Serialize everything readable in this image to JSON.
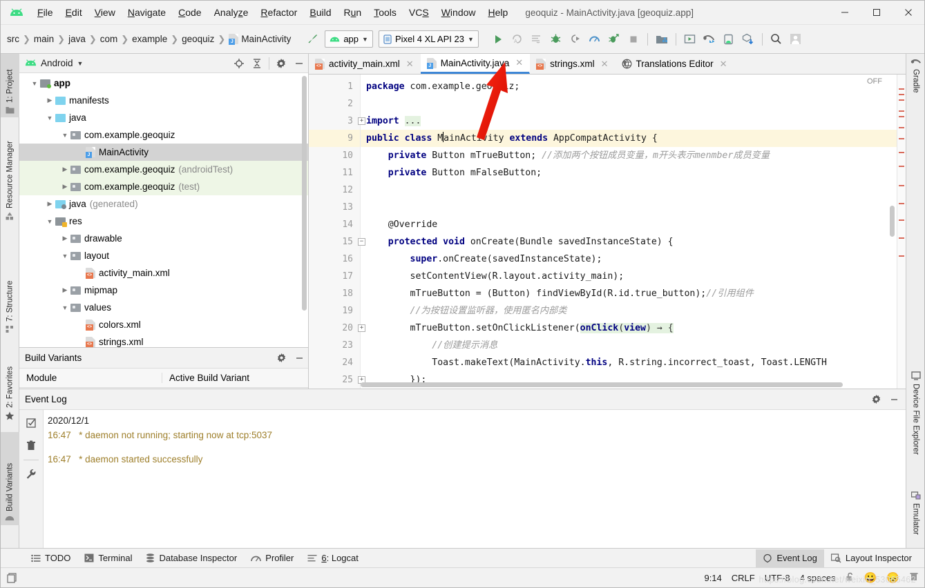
{
  "window": {
    "title": "geoquiz - MainActivity.java [geoquiz.app]",
    "minimize": "—",
    "maximize": "▫",
    "close": "✕"
  },
  "menu": [
    {
      "label": "File",
      "accel": "F"
    },
    {
      "label": "Edit",
      "accel": "E"
    },
    {
      "label": "View",
      "accel": "V"
    },
    {
      "label": "Navigate",
      "accel": "N"
    },
    {
      "label": "Code",
      "accel": "C"
    },
    {
      "label": "Analyze",
      "accel": "z"
    },
    {
      "label": "Refactor",
      "accel": "R"
    },
    {
      "label": "Build",
      "accel": "B"
    },
    {
      "label": "Run",
      "accel": "u"
    },
    {
      "label": "Tools",
      "accel": "T"
    },
    {
      "label": "VCS",
      "accel": "S"
    },
    {
      "label": "Window",
      "accel": "W"
    },
    {
      "label": "Help",
      "accel": "H"
    }
  ],
  "breadcrumbs": [
    "src",
    "main",
    "java",
    "com",
    "example",
    "geoquiz",
    "MainActivity"
  ],
  "toolbar": {
    "module_selector": "app",
    "device_selector": "Pixel 4 XL API 23",
    "icons": [
      "run-icon",
      "rerun-icon",
      "run-with-coverage-icon",
      "debug-icon",
      "attach-debugger-icon",
      "profiler-icon",
      "debug-app-icon",
      "stop-icon",
      "sdk-manager-icon",
      "avd-manager-icon",
      "sync-gradle-icon",
      "device-manager-icon",
      "download-component-icon",
      "search-icon",
      "account-icon"
    ],
    "make_project_icon": "hammer-icon"
  },
  "left_tool_strip": [
    {
      "label": "1: Project",
      "accel": "1",
      "icon": "project-folder-icon",
      "selected": true
    },
    {
      "label": "Resource Manager",
      "icon": "resource-manager-icon",
      "selected": false
    },
    {
      "label": "7: Structure",
      "accel": "7",
      "icon": "structure-icon",
      "selected": false
    },
    {
      "label": "2: Favorites",
      "accel": "2",
      "icon": "star-icon",
      "selected": false
    },
    {
      "label": "Build Variants",
      "icon": "android-icon",
      "selected": true
    }
  ],
  "right_tool_strip": [
    {
      "label": "Gradle",
      "icon": "gradle-elephant-icon"
    },
    {
      "label": "Device File Explorer",
      "icon": "device-screen-icon"
    },
    {
      "label": "Emulator",
      "icon": "emulator-icon"
    }
  ],
  "project_panel": {
    "title": "Android",
    "dropdown_caret": "▼",
    "header_icons": [
      "locate-icon",
      "collapse-all-icon",
      "settings-gear-icon",
      "minimize-icon"
    ],
    "tree": [
      {
        "indent": 0,
        "arrow": "▼",
        "icon": "folder-module",
        "label": "app",
        "suffix": "",
        "bold": true,
        "selected": false,
        "green": false
      },
      {
        "indent": 1,
        "arrow": "▶",
        "icon": "folder-blue",
        "label": "manifests",
        "suffix": "",
        "bold": false,
        "selected": false,
        "green": false
      },
      {
        "indent": 1,
        "arrow": "▼",
        "icon": "folder-blue",
        "label": "java",
        "suffix": "",
        "bold": false,
        "selected": false,
        "green": false
      },
      {
        "indent": 2,
        "arrow": "▼",
        "icon": "folder-package",
        "label": "com.example.geoquiz",
        "suffix": "",
        "bold": false,
        "selected": false,
        "green": false
      },
      {
        "indent": 3,
        "arrow": "",
        "icon": "file-java",
        "label": "MainActivity",
        "suffix": "",
        "bold": false,
        "selected": true,
        "green": false
      },
      {
        "indent": 2,
        "arrow": "▶",
        "icon": "folder-package",
        "label": "com.example.geoquiz",
        "suffix": "(androidTest)",
        "bold": false,
        "selected": false,
        "green": true
      },
      {
        "indent": 2,
        "arrow": "▶",
        "icon": "folder-package",
        "label": "com.example.geoquiz",
        "suffix": "(test)",
        "bold": false,
        "selected": false,
        "green": true
      },
      {
        "indent": 1,
        "arrow": "▶",
        "icon": "folder-generated",
        "label": "java",
        "suffix": "(generated)",
        "bold": false,
        "selected": false,
        "green": false
      },
      {
        "indent": 1,
        "arrow": "▼",
        "icon": "folder-res",
        "label": "res",
        "suffix": "",
        "bold": false,
        "selected": false,
        "green": false
      },
      {
        "indent": 2,
        "arrow": "▶",
        "icon": "folder-package",
        "label": "drawable",
        "suffix": "",
        "bold": false,
        "selected": false,
        "green": false
      },
      {
        "indent": 2,
        "arrow": "▼",
        "icon": "folder-package",
        "label": "layout",
        "suffix": "",
        "bold": false,
        "selected": false,
        "green": false
      },
      {
        "indent": 3,
        "arrow": "",
        "icon": "file-xml",
        "label": "activity_main.xml",
        "suffix": "",
        "bold": false,
        "selected": false,
        "green": false
      },
      {
        "indent": 2,
        "arrow": "▶",
        "icon": "folder-package",
        "label": "mipmap",
        "suffix": "",
        "bold": false,
        "selected": false,
        "green": false
      },
      {
        "indent": 2,
        "arrow": "▼",
        "icon": "folder-package",
        "label": "values",
        "suffix": "",
        "bold": false,
        "selected": false,
        "green": false
      },
      {
        "indent": 3,
        "arrow": "",
        "icon": "file-xml",
        "label": "colors.xml",
        "suffix": "",
        "bold": false,
        "selected": false,
        "green": false
      },
      {
        "indent": 3,
        "arrow": "",
        "icon": "file-xml",
        "label": "strings.xml",
        "suffix": "",
        "bold": false,
        "selected": false,
        "green": false
      }
    ]
  },
  "build_variants": {
    "title": "Build Variants",
    "header_icons": [
      "settings-gear-icon",
      "minimize-icon"
    ],
    "columns": [
      "Module",
      "Active Build Variant"
    ]
  },
  "editor": {
    "tabs": [
      {
        "label": "activity_main.xml",
        "icon": "file-xml",
        "active": false,
        "close": "✕"
      },
      {
        "label": "MainActivity.java",
        "icon": "file-java",
        "active": true,
        "close": "✕"
      },
      {
        "label": "strings.xml",
        "icon": "file-xml",
        "active": false,
        "close": "✕"
      },
      {
        "label": "Translations Editor",
        "icon": "globe-icon",
        "active": false,
        "close": "✕"
      }
    ],
    "inspection_badge": "OFF",
    "lines": [
      {
        "num": "1",
        "fold": "",
        "highlight": false,
        "tokens": [
          {
            "t": "package ",
            "c": "kw"
          },
          {
            "t": "com.example.geoquiz;",
            "c": "txt"
          }
        ]
      },
      {
        "num": "2",
        "fold": "",
        "highlight": false,
        "tokens": []
      },
      {
        "num": "3",
        "fold": "+",
        "highlight": false,
        "tokens": [
          {
            "t": "import ",
            "c": "kw"
          },
          {
            "t": "...",
            "c": "lam-plain"
          }
        ]
      },
      {
        "num": "9",
        "fold": "",
        "highlight": true,
        "tokens": [
          {
            "t": "public class ",
            "c": "kw"
          },
          {
            "t": "MainActivity ",
            "c": "txt"
          },
          {
            "t": "extends ",
            "c": "kw"
          },
          {
            "t": "AppCompatActivity {",
            "c": "txt"
          }
        ]
      },
      {
        "num": "10",
        "fold": "",
        "highlight": false,
        "tokens": [
          {
            "t": "    private ",
            "c": "kw"
          },
          {
            "t": "Button mTrueButton; ",
            "c": "txt"
          },
          {
            "t": "//添加两个按钮成员变量，m开头表示menmber成员变量",
            "c": "cmt"
          }
        ]
      },
      {
        "num": "11",
        "fold": "",
        "highlight": false,
        "tokens": [
          {
            "t": "    private ",
            "c": "kw"
          },
          {
            "t": "Button mFalseButton;",
            "c": "txt"
          }
        ]
      },
      {
        "num": "12",
        "fold": "",
        "highlight": false,
        "tokens": []
      },
      {
        "num": "13",
        "fold": "",
        "highlight": false,
        "tokens": []
      },
      {
        "num": "14",
        "fold": "",
        "highlight": false,
        "tokens": [
          {
            "t": "    @Override",
            "c": "txt"
          }
        ]
      },
      {
        "num": "15",
        "fold": "-",
        "highlight": false,
        "tokens": [
          {
            "t": "    protected void ",
            "c": "kw"
          },
          {
            "t": "onCreate(Bundle savedInstanceState) {",
            "c": "txt"
          }
        ]
      },
      {
        "num": "16",
        "fold": "",
        "highlight": false,
        "tokens": [
          {
            "t": "        ",
            "c": "txt"
          },
          {
            "t": "super",
            "c": "kw"
          },
          {
            "t": ".onCreate(savedInstanceState);",
            "c": "txt"
          }
        ]
      },
      {
        "num": "17",
        "fold": "",
        "highlight": false,
        "tokens": [
          {
            "t": "        setContentView(R.layout.activity_main);",
            "c": "txt"
          }
        ]
      },
      {
        "num": "18",
        "fold": "",
        "highlight": false,
        "tokens": [
          {
            "t": "        mTrueButton = (Button) findViewById(R.id.true_button);",
            "c": "txt"
          },
          {
            "t": "//引用组件",
            "c": "cmt"
          }
        ]
      },
      {
        "num": "19",
        "fold": "",
        "highlight": false,
        "tokens": [
          {
            "t": "        //为按钮设置监听器，使用匿名内部类",
            "c": "cmt"
          }
        ]
      },
      {
        "num": "20",
        "fold": "+",
        "highlight": false,
        "tokens": [
          {
            "t": "        mTrueButton.setOnClickListener(",
            "c": "txt"
          },
          {
            "t": "onClick",
            "c": "lam"
          },
          {
            "t": "(",
            "c": "lam-plain"
          },
          {
            "t": "view",
            "c": "lam"
          },
          {
            "t": ") → {",
            "c": "lam-plain"
          }
        ]
      },
      {
        "num": "23",
        "fold": "",
        "highlight": false,
        "tokens": [
          {
            "t": "            //创建提示消息",
            "c": "cmt"
          }
        ]
      },
      {
        "num": "24",
        "fold": "",
        "highlight": false,
        "tokens": [
          {
            "t": "            Toast.makeText(MainActivity.",
            "c": "txt"
          },
          {
            "t": "this",
            "c": "kw"
          },
          {
            "t": ", R.string.incorrect_toast, Toast.LENGTH",
            "c": "txt"
          }
        ]
      },
      {
        "num": "25",
        "fold": "+",
        "highlight": false,
        "tokens": [
          {
            "t": "        });",
            "c": "txt"
          }
        ]
      }
    ]
  },
  "event_log": {
    "title": "Event Log",
    "header_icons": [
      "settings-gear-icon",
      "minimize-icon"
    ],
    "gutter_icons": [
      "mark-read-icon",
      "trash-icon",
      "wrench-icon"
    ],
    "date": "2020/12/1",
    "entries": [
      {
        "time": "16:47",
        "message": "* daemon not running; starting now at tcp:5037"
      },
      {
        "time": "16:47",
        "message": "* daemon started successfully"
      }
    ]
  },
  "bottom_bar": {
    "left_items": [
      {
        "label": "TODO",
        "icon": "todo-list-icon",
        "selected": false
      },
      {
        "label": "Terminal",
        "icon": "terminal-icon",
        "selected": false
      },
      {
        "label": "Database Inspector",
        "icon": "database-icon",
        "selected": false
      },
      {
        "label": "Profiler",
        "icon": "profiler-gauge-icon",
        "selected": false
      },
      {
        "label": "6: Logcat",
        "accel": "6",
        "icon": "logcat-icon",
        "selected": false
      }
    ],
    "right_items": [
      {
        "label": "Event Log",
        "icon": "event-log-icon",
        "selected": true
      },
      {
        "label": "Layout Inspector",
        "icon": "layout-inspector-icon",
        "selected": false
      }
    ]
  },
  "status_bar": {
    "caret_position": "9:14",
    "line_separator": "CRLF",
    "encoding": "UTF-8",
    "indent": "4 spaces",
    "lock_icon": "unlock-icon",
    "emoji_happy": "😀",
    "emoji_sad": "😞",
    "memory_icon": "trash-indicator-icon",
    "watermark": "https://blog.csdn.net/weixin_53065462"
  },
  "annotation": {
    "arrow_color": "#e8180c",
    "name": "red-arrow-pointing-to-mainactivity-tab"
  }
}
